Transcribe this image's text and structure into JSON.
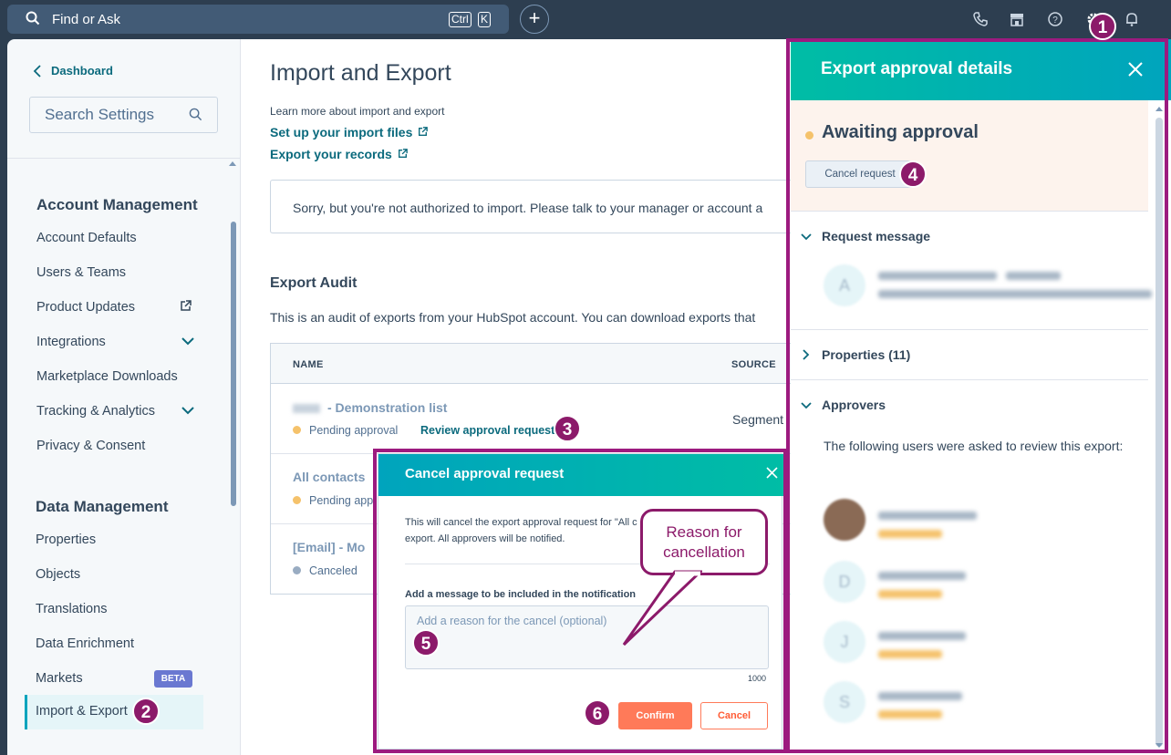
{
  "topbar": {
    "search_text": "Find or Ask",
    "shortcut_keys": [
      "Ctrl",
      "K"
    ]
  },
  "sidebar": {
    "back_label": "Dashboard",
    "search_placeholder": "Search Settings",
    "sections": [
      {
        "title": "Account Management",
        "items": [
          "Account Defaults",
          "Users & Teams",
          "Product Updates",
          "Integrations",
          "Marketplace Downloads",
          "Tracking & Analytics",
          "Privacy & Consent"
        ]
      },
      {
        "title": "Data Management",
        "items": [
          "Properties",
          "Objects",
          "Translations",
          "Data Enrichment",
          "Markets",
          "Import & Export"
        ]
      }
    ],
    "beta_badge": "BETA",
    "active_item": "Import & Export"
  },
  "main": {
    "title": "Import and Export",
    "learn_more": "Learn more about import and export",
    "links": [
      "Set up your import files",
      "Export your records"
    ],
    "alert": "Sorry, but you're not authorized to import. Please talk to your manager or account a",
    "audit_title": "Export Audit",
    "audit_desc": "This is an audit of exports from your HubSpot account. You can download exports that",
    "table": {
      "headers": [
        "NAME",
        "SOURCE"
      ],
      "rows": [
        {
          "name": "- Demonstration list",
          "status": "Pending approval",
          "action": "Review approval request",
          "source": "Segment",
          "status_color": "#f5c26b"
        },
        {
          "name": "All contacts",
          "status": "Pending app",
          "status_color": "#f5c26b"
        },
        {
          "name": "[Email] - Mo",
          "status": "Canceled",
          "status_color": "#99acc2"
        }
      ]
    }
  },
  "panel": {
    "title": "Export approval details",
    "status": "Awaiting approval",
    "cancel_request": "Cancel request",
    "sections": [
      "Request message",
      "Properties (11)",
      "Approvers"
    ],
    "approvers_text": "The following users were asked to review this export:",
    "approver_initials": [
      "D",
      "J",
      "S"
    ]
  },
  "modal": {
    "title": "Cancel approval request",
    "body": "This will cancel the export approval request for \"All c export. All approvers will be notified.",
    "label": "Add a message to be included in the notification",
    "placeholder": "Add a reason for the cancel (optional)",
    "char_limit": "1000",
    "confirm": "Confirm",
    "cancel": "Cancel"
  },
  "annotations": {
    "badges": [
      "1",
      "2",
      "3",
      "4",
      "5",
      "6"
    ],
    "callout": "Reason for cancellation",
    "color": "#9c1a7f"
  },
  "colors": {
    "accent": "#00a4bd",
    "link": "#0b6a7d",
    "primary_button": "#ff7a59",
    "nav_bg": "#2d3e50"
  }
}
